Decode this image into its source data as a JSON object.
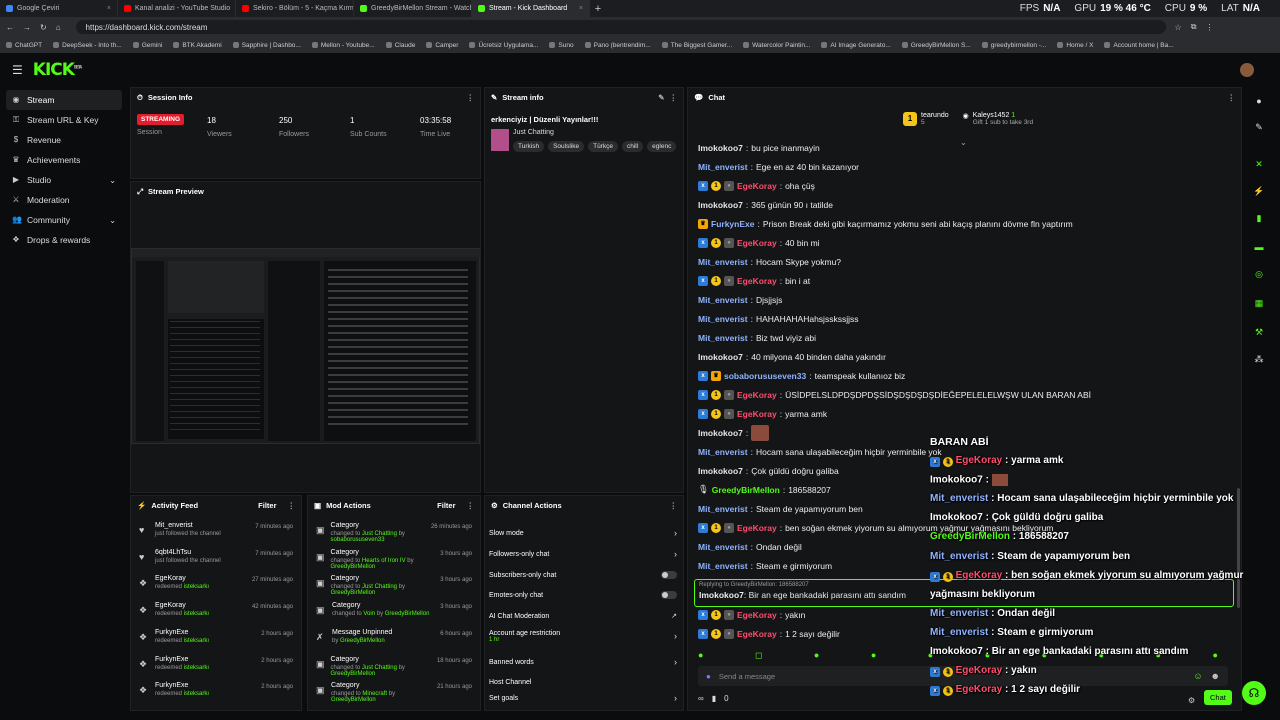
{
  "browser": {
    "tabs": [
      {
        "title": "Google Çeviri",
        "color": "#4285f4",
        "active": false
      },
      {
        "title": "Kanal analizi - YouTube Studio",
        "color": "#ff0000",
        "active": false
      },
      {
        "title": "Sekiro - Bölüm - 5 - Kaçma Kırmız",
        "color": "#ff0000",
        "active": false
      },
      {
        "title": "GreedyBirMellon Stream - Watch...",
        "color": "#53fc18",
        "active": false
      },
      {
        "title": "Stream - Kick Dashboard",
        "color": "#53fc18",
        "active": true
      }
    ],
    "url": "https://dashboard.kick.com/stream",
    "bookmarks": [
      "ChatGPT",
      "DeepSeek - Into th...",
      "Gemini",
      "BTK Akademi",
      "Sapphire | Dashbo...",
      "Mellon - Youtube...",
      "Claude",
      "Camper",
      "Ücretsiz Uygulama...",
      "Suno",
      "Pano (bentrendim...",
      "The Biggest Gamer...",
      "Watercolor Paintin...",
      "AI Image Generato...",
      "GreedyBirMellon S...",
      "greedybirmellon -...",
      "Home / X",
      "Account home | Ba..."
    ],
    "perf": {
      "fps_label": "FPS",
      "fps": "N/A",
      "gpu_label": "GPU",
      "gpu": "19 % 46 °C",
      "cpu_label": "CPU",
      "cpu": "9 %",
      "lat_label": "LAT",
      "lat": "N/A"
    }
  },
  "app": {
    "logo": "KICK",
    "logo_sup": "BETA"
  },
  "sidebar": {
    "items": [
      {
        "label": "Stream",
        "icon": "play-icon",
        "active": true
      },
      {
        "label": "Stream URL & Key",
        "icon": "key-icon"
      },
      {
        "label": "Revenue",
        "icon": "money-icon"
      },
      {
        "label": "Achievements",
        "icon": "trophy-icon"
      },
      {
        "label": "Studio",
        "icon": "video-icon",
        "chevron": true
      },
      {
        "label": "Moderation",
        "icon": "sword-icon"
      },
      {
        "label": "Community",
        "icon": "users-icon",
        "chevron": true
      },
      {
        "label": "Drops & rewards",
        "icon": "gift-icon"
      }
    ]
  },
  "session": {
    "title": "Session Info",
    "status": "STREAMING",
    "session_label": "Session",
    "viewers": "18",
    "viewers_label": "Viewers",
    "followers": "250",
    "followers_label": "Followers",
    "subs": "1",
    "subs_label": "Sub Counts",
    "time": "03:35:58",
    "time_label": "Time Live"
  },
  "preview": {
    "title": "Stream Preview"
  },
  "stream_info": {
    "title": "Stream info",
    "stream_title": "erkenciyiz | Düzenli Yayınlar!!!",
    "category": "Just Chatting",
    "tags": [
      "Turkish",
      "Soulslike",
      "Türkçe",
      "chill",
      "eglenc"
    ]
  },
  "activity": {
    "title": "Activity Feed",
    "filter": "Filter",
    "items": [
      {
        "name": "Mit_enverist",
        "desc": "just followed the channel",
        "time": "7 minutes ago",
        "icon": "heart-icon"
      },
      {
        "name": "6qbt4LhTsu",
        "desc": "just followed the channel",
        "time": "7 minutes ago",
        "icon": "heart-icon"
      },
      {
        "name": "EgeKoray",
        "desc": "redeemed",
        "reward": "isteksarkı",
        "time": "27 minutes ago",
        "icon": "reward-icon"
      },
      {
        "name": "EgeKoray",
        "desc": "redeemed",
        "reward": "isteksarkı",
        "time": "42 minutes ago",
        "icon": "reward-icon"
      },
      {
        "name": "FurkynExe",
        "desc": "redeemed",
        "reward": "isteksarkı",
        "time": "2 hours ago",
        "icon": "reward-icon"
      },
      {
        "name": "FurkynExe",
        "desc": "redeemed",
        "reward": "isteksarkı",
        "time": "2 hours ago",
        "icon": "reward-icon"
      },
      {
        "name": "FurkynExe",
        "desc": "redeemed",
        "reward": "isteksarkı",
        "time": "2 hours ago",
        "icon": "reward-icon"
      }
    ]
  },
  "mod": {
    "title": "Mod Actions",
    "filter": "Filter",
    "items": [
      {
        "title": "Category",
        "pre": "changed to",
        "hl": "Just Chatting",
        "mid": "by",
        "by": "sobaborususeven33",
        "time": "26 minutes ago",
        "icon": "category-icon"
      },
      {
        "title": "Category",
        "pre": "changed to",
        "hl": "Hearts of Iron IV",
        "mid": "by",
        "by": "GreedyBirMellon",
        "time": "3 hours ago",
        "icon": "category-icon"
      },
      {
        "title": "Category",
        "pre": "changed to",
        "hl": "Just Chatting",
        "mid": "by",
        "by": "GreedyBirMellon",
        "time": "3 hours ago",
        "icon": "category-icon"
      },
      {
        "title": "Category",
        "pre": "changed to",
        "hl": "Voin",
        "mid": "by",
        "by": "GreedyBirMellon",
        "time": "3 hours ago",
        "icon": "category-icon"
      },
      {
        "title": "Message Unpinned",
        "pre": "",
        "hl": "",
        "mid": "by",
        "by": "GreedyBirMellon",
        "time": "6 hours ago",
        "icon": "unpin-icon"
      },
      {
        "title": "Category",
        "pre": "changed to",
        "hl": "Just Chatting",
        "mid": "by",
        "by": "GreedyBirMellon",
        "time": "18 hours ago",
        "icon": "category-icon"
      },
      {
        "title": "Category",
        "pre": "changed to",
        "hl": "Minecraft",
        "mid": "by",
        "by": "GreedyBirMellon",
        "time": "21 hours ago",
        "icon": "category-icon"
      }
    ]
  },
  "channel_actions": {
    "title": "Channel Actions",
    "items": [
      {
        "label": "Slow mode",
        "ctrl": "arrow"
      },
      {
        "label": "Followers-only chat",
        "ctrl": "arrow"
      },
      {
        "label": "Subscribers-only chat",
        "ctrl": "toggle"
      },
      {
        "label": "Emotes-only chat",
        "ctrl": "toggle"
      },
      {
        "label": "AI Chat Moderation",
        "ctrl": "ext"
      },
      {
        "label": "Account age restriction",
        "sub": "1 hr",
        "ctrl": "arrow"
      },
      {
        "label": "Banned words",
        "ctrl": "arrow"
      },
      {
        "label": "Host Channel",
        "ctrl": "none"
      },
      {
        "label": "Set goals",
        "ctrl": "arrow"
      }
    ]
  },
  "chat": {
    "title": "Chat",
    "leader1": {
      "name": "tearundo",
      "rank": "1",
      "count": "5"
    },
    "leader2": {
      "name": "Kaleys1452",
      "count": "1",
      "note": "Gift 1 sub to take 3rd"
    },
    "messages": [
      {
        "user": "Imokokoo7",
        "color": "#e6e6e6",
        "text": "bu pice inanmayin",
        "badges": []
      },
      {
        "user": "Mit_enverist",
        "color": "#8fb3ff",
        "text": "Ege en az 40 bin kazanıyor",
        "badges": []
      },
      {
        "user": "EgeKoray",
        "color": "#ff4d6d",
        "text": "oha çüş",
        "badges": [
          "blue",
          "gold",
          "gray"
        ]
      },
      {
        "user": "Imokokoo7",
        "color": "#e6e6e6",
        "text": "365 günün 90 ı tatilde",
        "badges": []
      },
      {
        "user": "FurkynExe",
        "color": "#8fb3ff",
        "text": "Prison Break deki gibi kaçırmamız yokmu seni abi kaçış planını dövme fln yaptırım",
        "badges": [
          "crown"
        ]
      },
      {
        "user": "EgeKoray",
        "color": "#ff4d6d",
        "text": "40 bin mi",
        "badges": [
          "blue",
          "gold",
          "gray"
        ]
      },
      {
        "user": "Mit_enverist",
        "color": "#8fb3ff",
        "text": "Hocam Skype yokmu?",
        "badges": []
      },
      {
        "user": "EgeKoray",
        "color": "#ff4d6d",
        "text": "bin i at",
        "badges": [
          "blue",
          "gold",
          "gray"
        ]
      },
      {
        "user": "Mit_enverist",
        "color": "#8fb3ff",
        "text": "Djsjjsjs",
        "badges": []
      },
      {
        "user": "Mit_enverist",
        "color": "#8fb3ff",
        "text": "HAHAHAHAHahsjsskssjjss",
        "badges": []
      },
      {
        "user": "Mit_enverist",
        "color": "#8fb3ff",
        "text": "Biz twd viyiz abi",
        "badges": []
      },
      {
        "user": "Imokokoo7",
        "color": "#e6e6e6",
        "text": "40 milyona 40 binden daha yakındır",
        "badges": []
      },
      {
        "user": "sobaborususeven33",
        "color": "#8fb3ff",
        "text": "teamspeak kullanıoz biz",
        "badges": [
          "blue",
          "crown"
        ]
      },
      {
        "user": "EgeKoray",
        "color": "#ff4d6d",
        "text": "ÜSİDPELSLDPDŞDPDŞSİDŞDŞDŞDŞDİEĞEPELELELWŞW ULAN BARAN ABİ",
        "badges": [
          "blue",
          "gold",
          "gray"
        ]
      },
      {
        "user": "EgeKoray",
        "color": "#ff4d6d",
        "text": "yarma amk",
        "badges": [
          "blue",
          "gold",
          "gray"
        ]
      },
      {
        "user": "Imokokoo7",
        "color": "#e6e6e6",
        "text": "",
        "badges": [],
        "emote": true
      },
      {
        "user": "Mit_enverist",
        "color": "#8fb3ff",
        "text": "Hocam sana ulaşabileceğim hiçbir yerminbile yok",
        "badges": []
      },
      {
        "user": "Imokokoo7",
        "color": "#e6e6e6",
        "text": "Çok güldü doğru galiba",
        "badges": []
      },
      {
        "user": "GreedyBirMellon",
        "color": "#53fc18",
        "text": "186588207",
        "badges": [
          "mic"
        ]
      },
      {
        "user": "Mit_enverist",
        "color": "#8fb3ff",
        "text": "Steam de yapamıyorum ben",
        "badges": []
      },
      {
        "user": "EgeKoray",
        "color": "#ff4d6d",
        "text": "ben soğan ekmek yiyorum su almıyorum yağmur yağmasını bekliyorum",
        "badges": [
          "blue",
          "gold",
          "gray"
        ]
      },
      {
        "user": "Mit_enverist",
        "color": "#8fb3ff",
        "text": "Ondan değil",
        "badges": []
      },
      {
        "user": "Mit_enverist",
        "color": "#8fb3ff",
        "text": "Steam e girmiyorum",
        "badges": []
      }
    ],
    "reply_note": "Replying to GreedyBirMellon: 186588207",
    "reply_user": "Imokokoo7",
    "reply_text": "Bir an ege bankadaki parasını attı sandım",
    "after": [
      {
        "user": "EgeKoray",
        "color": "#ff4d6d",
        "text": "yakın",
        "badges": [
          "blue",
          "gold",
          "gray"
        ]
      },
      {
        "user": "EgeKoray",
        "color": "#ff4d6d",
        "text": "1 2 sayı değilir",
        "badges": [
          "blue",
          "gold",
          "gray"
        ]
      }
    ],
    "input_placeholder": "Send a message",
    "viewer_count": "0",
    "chat_button": "Chat"
  },
  "overlay": {
    "heading": "BARAN ABİ",
    "lines": [
      {
        "user": "EgeKoray",
        "color": "#ff4d6d",
        "text": "yarma amk",
        "badges": true
      },
      {
        "user": "Imokokoo7",
        "color": "#ffffff",
        "text": "",
        "badges": false,
        "emote": true
      },
      {
        "user": "Mit_enverist",
        "color": "#8fb3ff",
        "text": "Hocam sana ulaşabileceğim hiçbir yerminbile yok",
        "badges": false
      },
      {
        "user": "Imokokoo7",
        "color": "#ffffff",
        "text": "Çok güldü doğru galiba",
        "badges": false
      },
      {
        "user": "GreedyBirMellon",
        "color": "#53fc18",
        "text": "186588207",
        "badges": false
      },
      {
        "user": "Mit_enverist",
        "color": "#8fb3ff",
        "text": "Steam de yapamıyorum ben",
        "badges": false
      },
      {
        "user": "EgeKoray",
        "color": "#ff4d6d",
        "text": "ben soğan ekmek yiyorum su almıyorum yağmur",
        "badges": true
      },
      {
        "user": "",
        "color": "#ffffff",
        "text": "yağmasını bekliyorum",
        "badges": false
      },
      {
        "user": "Mit_enverist",
        "color": "#8fb3ff",
        "text": "Ondan değil",
        "badges": false
      },
      {
        "user": "Mit_enverist",
        "color": "#8fb3ff",
        "text": "Steam e girmiyorum",
        "badges": false
      },
      {
        "user": "Imokokoo7",
        "color": "#ffffff",
        "text": "Bir an ege bankadaki parasını attı sandım",
        "badges": false
      },
      {
        "user": "EgeKoray",
        "color": "#ff4d6d",
        "text": "yakın",
        "badges": true
      },
      {
        "user": "EgeKoray",
        "color": "#ff4d6d",
        "text": "1 2 sayı değilir",
        "badges": true
      }
    ]
  }
}
